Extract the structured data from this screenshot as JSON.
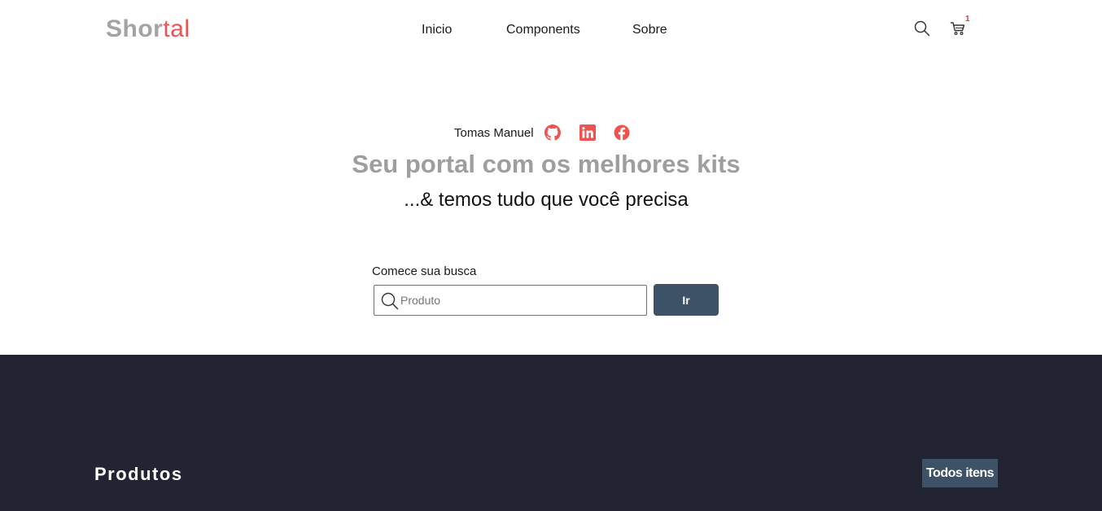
{
  "header": {
    "logo_part1": "Shor",
    "logo_part2": "tal",
    "nav": [
      {
        "label": "Inicio"
      },
      {
        "label": "Components"
      },
      {
        "label": "Sobre"
      }
    ],
    "search_icon": "search-icon",
    "cart_icon": "cart-icon",
    "cart_count": "1"
  },
  "hero": {
    "author": "Tomas Manuel",
    "social_icons": [
      "github-icon",
      "linkedin-icon",
      "facebook-icon"
    ],
    "headline": "Seu portal com os melhores kits",
    "subline": "...& temos tudo que você precisa"
  },
  "search": {
    "label": "Comece sua busca",
    "placeholder": "Produto",
    "value": "",
    "button_label": "Ir"
  },
  "products": {
    "title": "Produtos",
    "all_button": "Todos itens"
  },
  "colors": {
    "accent": "#ef5350",
    "logo_gray": "#a3a3a3",
    "button": "#3d5167",
    "dark_section": "#222433"
  }
}
